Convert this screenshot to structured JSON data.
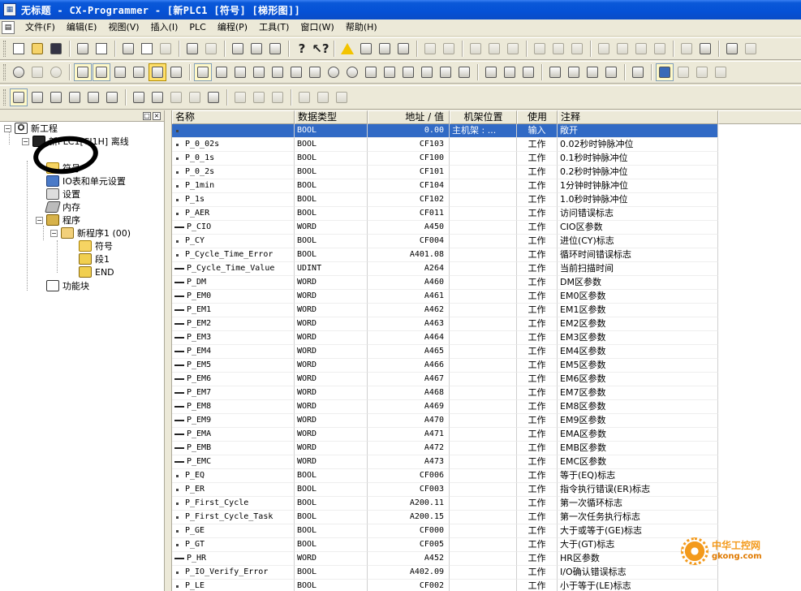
{
  "window": {
    "title": "无标题 - CX-Programmer - [新PLC1 [符号] [梯形图]]",
    "icon": "app-icon"
  },
  "menu": {
    "items": [
      "文件(F)",
      "编辑(E)",
      "视图(V)",
      "插入(I)",
      "PLC",
      "编程(P)",
      "工具(T)",
      "窗口(W)",
      "帮助(H)"
    ]
  },
  "tree": {
    "project": "新工程",
    "plc": "新PLC1[CJ1H] 离线",
    "symbols": "符号",
    "io_table": "IO表和单元设置",
    "settings": "设置",
    "memory": "内存",
    "programs": "程序",
    "program1": "新程序1 (00)",
    "program_symbols": "符号",
    "section1": "段1",
    "end": "END",
    "function_blocks": "功能块"
  },
  "table": {
    "headers": {
      "name": "名称",
      "type": "数据类型",
      "address": "地址 / 值",
      "rack": "机架位置",
      "usage": "使用",
      "comment": "注释"
    },
    "rows": [
      {
        "marker": "bool",
        "name": "",
        "type": "BOOL",
        "address": "0.00",
        "rack": "主机架 : ...",
        "usage": "输入",
        "comment": "敞开",
        "selected": true
      },
      {
        "marker": "bool",
        "name": "P_0_02s",
        "type": "BOOL",
        "address": "CF103",
        "rack": "",
        "usage": "工作",
        "comment": "0.02秒时钟脉冲位"
      },
      {
        "marker": "bool",
        "name": "P_0_1s",
        "type": "BOOL",
        "address": "CF100",
        "rack": "",
        "usage": "工作",
        "comment": "0.1秒时钟脉冲位"
      },
      {
        "marker": "bool",
        "name": "P_0_2s",
        "type": "BOOL",
        "address": "CF101",
        "rack": "",
        "usage": "工作",
        "comment": "0.2秒时钟脉冲位"
      },
      {
        "marker": "bool",
        "name": "P_1min",
        "type": "BOOL",
        "address": "CF104",
        "rack": "",
        "usage": "工作",
        "comment": "1分钟时钟脉冲位"
      },
      {
        "marker": "bool",
        "name": "P_1s",
        "type": "BOOL",
        "address": "CF102",
        "rack": "",
        "usage": "工作",
        "comment": "1.0秒时钟脉冲位"
      },
      {
        "marker": "bool",
        "name": "P_AER",
        "type": "BOOL",
        "address": "CF011",
        "rack": "",
        "usage": "工作",
        "comment": "访问错误标志"
      },
      {
        "marker": "word",
        "name": "P_CIO",
        "type": "WORD",
        "address": "A450",
        "rack": "",
        "usage": "工作",
        "comment": "CIO区参数"
      },
      {
        "marker": "bool",
        "name": "P_CY",
        "type": "BOOL",
        "address": "CF004",
        "rack": "",
        "usage": "工作",
        "comment": "进位(CY)标志"
      },
      {
        "marker": "bool",
        "name": "P_Cycle_Time_Error",
        "type": "BOOL",
        "address": "A401.08",
        "rack": "",
        "usage": "工作",
        "comment": "循环时间错误标志"
      },
      {
        "marker": "word",
        "name": "P_Cycle_Time_Value",
        "type": "UDINT",
        "address": "A264",
        "rack": "",
        "usage": "工作",
        "comment": "当前扫描时间"
      },
      {
        "marker": "word",
        "name": "P_DM",
        "type": "WORD",
        "address": "A460",
        "rack": "",
        "usage": "工作",
        "comment": "DM区参数"
      },
      {
        "marker": "word",
        "name": "P_EM0",
        "type": "WORD",
        "address": "A461",
        "rack": "",
        "usage": "工作",
        "comment": "EM0区参数"
      },
      {
        "marker": "word",
        "name": "P_EM1",
        "type": "WORD",
        "address": "A462",
        "rack": "",
        "usage": "工作",
        "comment": "EM1区参数"
      },
      {
        "marker": "word",
        "name": "P_EM2",
        "type": "WORD",
        "address": "A463",
        "rack": "",
        "usage": "工作",
        "comment": "EM2区参数"
      },
      {
        "marker": "word",
        "name": "P_EM3",
        "type": "WORD",
        "address": "A464",
        "rack": "",
        "usage": "工作",
        "comment": "EM3区参数"
      },
      {
        "marker": "word",
        "name": "P_EM4",
        "type": "WORD",
        "address": "A465",
        "rack": "",
        "usage": "工作",
        "comment": "EM4区参数"
      },
      {
        "marker": "word",
        "name": "P_EM5",
        "type": "WORD",
        "address": "A466",
        "rack": "",
        "usage": "工作",
        "comment": "EM5区参数"
      },
      {
        "marker": "word",
        "name": "P_EM6",
        "type": "WORD",
        "address": "A467",
        "rack": "",
        "usage": "工作",
        "comment": "EM6区参数"
      },
      {
        "marker": "word",
        "name": "P_EM7",
        "type": "WORD",
        "address": "A468",
        "rack": "",
        "usage": "工作",
        "comment": "EM7区参数"
      },
      {
        "marker": "word",
        "name": "P_EM8",
        "type": "WORD",
        "address": "A469",
        "rack": "",
        "usage": "工作",
        "comment": "EM8区参数"
      },
      {
        "marker": "word",
        "name": "P_EM9",
        "type": "WORD",
        "address": "A470",
        "rack": "",
        "usage": "工作",
        "comment": "EM9区参数"
      },
      {
        "marker": "word",
        "name": "P_EMA",
        "type": "WORD",
        "address": "A471",
        "rack": "",
        "usage": "工作",
        "comment": "EMA区参数"
      },
      {
        "marker": "word",
        "name": "P_EMB",
        "type": "WORD",
        "address": "A472",
        "rack": "",
        "usage": "工作",
        "comment": "EMB区参数"
      },
      {
        "marker": "word",
        "name": "P_EMC",
        "type": "WORD",
        "address": "A473",
        "rack": "",
        "usage": "工作",
        "comment": "EMC区参数"
      },
      {
        "marker": "bool",
        "name": "P_EQ",
        "type": "BOOL",
        "address": "CF006",
        "rack": "",
        "usage": "工作",
        "comment": "等于(EQ)标志"
      },
      {
        "marker": "bool",
        "name": "P_ER",
        "type": "BOOL",
        "address": "CF003",
        "rack": "",
        "usage": "工作",
        "comment": "指令执行错误(ER)标志"
      },
      {
        "marker": "bool",
        "name": "P_First_Cycle",
        "type": "BOOL",
        "address": "A200.11",
        "rack": "",
        "usage": "工作",
        "comment": "第一次循环标志"
      },
      {
        "marker": "bool",
        "name": "P_First_Cycle_Task",
        "type": "BOOL",
        "address": "A200.15",
        "rack": "",
        "usage": "工作",
        "comment": "第一次任务执行标志"
      },
      {
        "marker": "bool",
        "name": "P_GE",
        "type": "BOOL",
        "address": "CF000",
        "rack": "",
        "usage": "工作",
        "comment": "大于或等于(GE)标志"
      },
      {
        "marker": "bool",
        "name": "P_GT",
        "type": "BOOL",
        "address": "CF005",
        "rack": "",
        "usage": "工作",
        "comment": "大于(GT)标志"
      },
      {
        "marker": "word",
        "name": "P_HR",
        "type": "WORD",
        "address": "A452",
        "rack": "",
        "usage": "工作",
        "comment": "HR区参数"
      },
      {
        "marker": "bool",
        "name": "P_IO_Verify_Error",
        "type": "BOOL",
        "address": "A402.09",
        "rack": "",
        "usage": "工作",
        "comment": "I/O确认错误标志"
      },
      {
        "marker": "bool",
        "name": "P_LE",
        "type": "BOOL",
        "address": "CF002",
        "rack": "",
        "usage": "工作",
        "comment": "小于等于(LE)标志"
      }
    ]
  },
  "watermark": {
    "text": "中华工控网",
    "domain": "gkong.com"
  }
}
